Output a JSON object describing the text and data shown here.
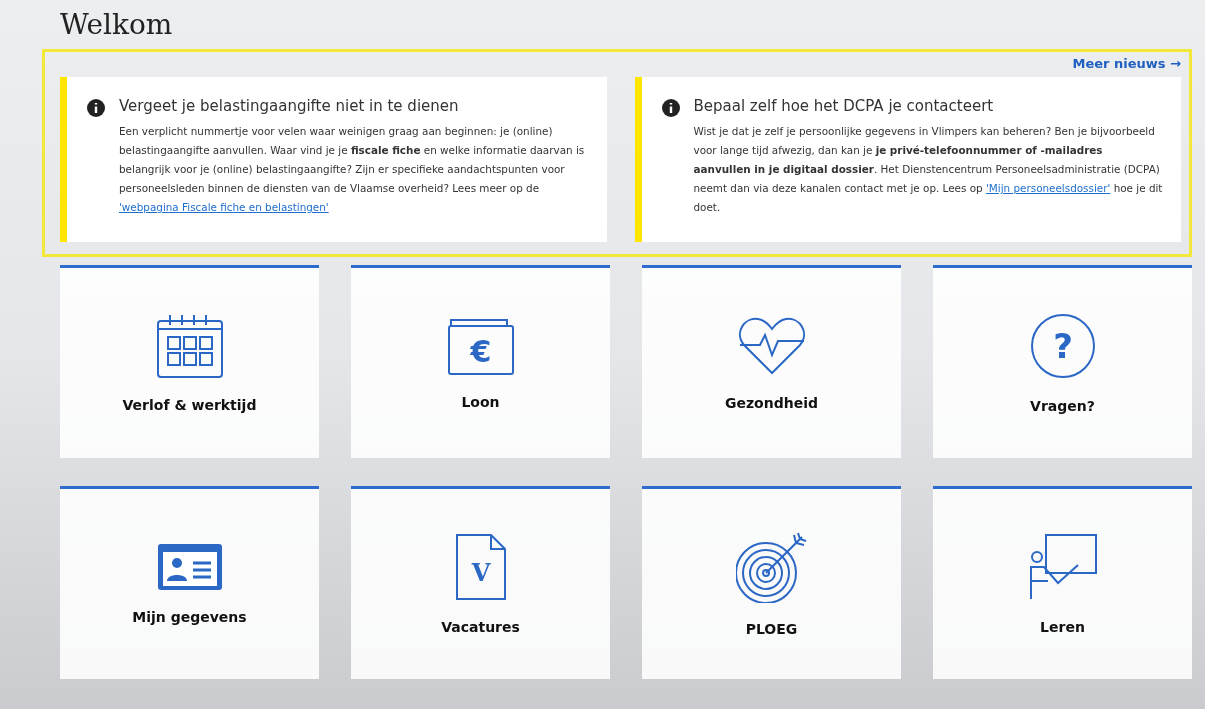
{
  "title": "Welkom",
  "news": {
    "more_link": "Meer nieuws →",
    "items": [
      {
        "title": "Vergeet je belastingaangifte niet in te dienen",
        "body": "Een verplicht nummertje voor velen waar weinigen graag aan beginnen: je (online) belastingaangifte aanvullen. Waar vind je je **fiscale fiche** en welke informatie daarvan is belangrijk voor je (online) belastingaangifte? Zijn er specifieke aandachtspunten voor personeelsleden binnen de diensten van de Vlaamse overheid? Lees meer op de",
        "link": "'webpagina Fiscale fiche en belastingen'"
      },
      {
        "title": "Bepaal zelf hoe het DCPA je contacteert",
        "body": "Wist je dat je zelf je persoonlijke gegevens in Vlimpers kan beheren? Ben je bijvoorbeeld voor lange tijd afwezig, dan kan je **je privé-telefoonnummer of -mailadres aanvullen in je digitaal dossier**. Het Dienstencentrum Personeelsadministratie (DCPA) neemt dan via deze kanalen contact met je op. Lees op",
        "link": "'Mijn personeelsdossier'",
        "after": "hoe je dit doet."
      }
    ]
  },
  "tiles": [
    {
      "kind": "calendar",
      "label": "Verlof & werktijd"
    },
    {
      "kind": "wallet",
      "label": "Loon",
      "icon_text": "€"
    },
    {
      "kind": "heart",
      "label": "Gezondheid"
    },
    {
      "kind": "question",
      "label": "Vragen?",
      "icon_text": "?"
    },
    {
      "kind": "idcard",
      "label": "Mijn gegevens"
    },
    {
      "kind": "document",
      "label": "Vacatures",
      "icon_text": "V"
    },
    {
      "kind": "target",
      "label": "PLOEG"
    },
    {
      "kind": "teacher",
      "label": "Leren"
    }
  ]
}
